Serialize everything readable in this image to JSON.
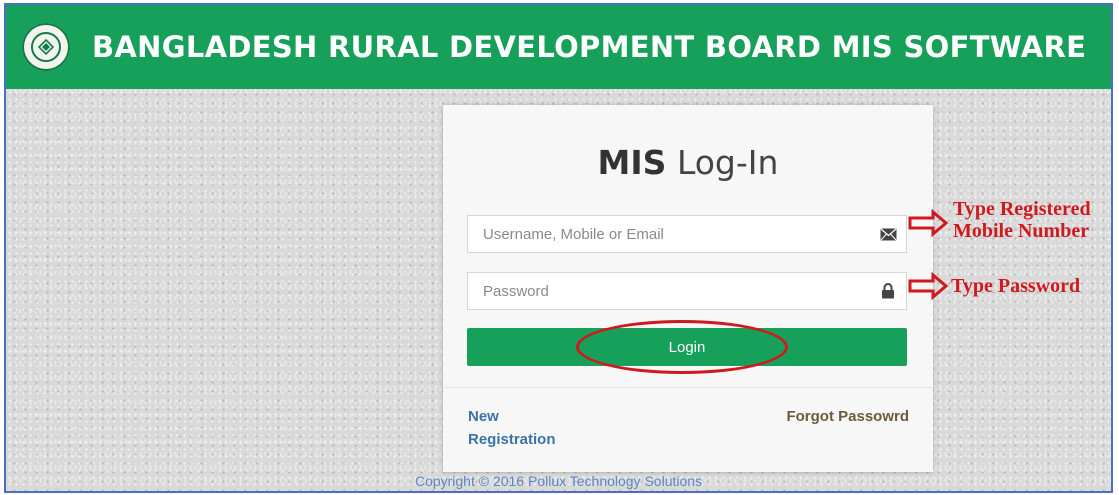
{
  "header": {
    "title": "BANGLADESH RURAL DEVELOPMENT BOARD MIS SOFTWARE",
    "logo_icon": "brdb-emblem-icon",
    "background": "#17a05a"
  },
  "login_card": {
    "title_bold": "MIS",
    "title_light": "Log-In",
    "username": {
      "placeholder": "Username, Mobile or Email",
      "value": "",
      "icon": "envelope-icon"
    },
    "password": {
      "placeholder": "Password",
      "value": "",
      "icon": "lock-icon"
    },
    "login_label": "Login",
    "new_registration": "New Registration",
    "forgot_password": "Forgot Passowrd"
  },
  "annotations": {
    "username_note_line1": "Type Registered",
    "username_note_line2": "Mobile Number",
    "password_note": "Type Password",
    "color": "#d0191f"
  },
  "footer": {
    "copyright": "Copyright © 2016 Pollux Technology Solutions"
  }
}
